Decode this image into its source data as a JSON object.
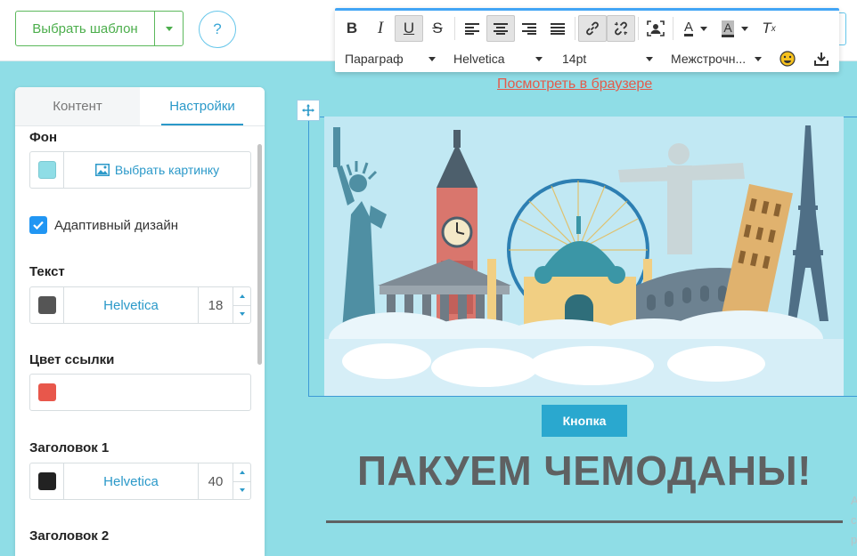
{
  "topbar": {
    "template_button": "Выбрать шаблон",
    "help_label": "?"
  },
  "editor_toolbar": {
    "paragraph_select": "Параграф",
    "font_select": "Helvetica",
    "size_select": "14pt",
    "line_height_select": "Межстрочн..."
  },
  "panel": {
    "tabs": [
      {
        "label": "Контент",
        "active": false
      },
      {
        "label": "Настройки",
        "active": true
      }
    ],
    "background": {
      "title": "Фон",
      "color": "#8fdde6",
      "pick_image_label": "Выбрать картинку"
    },
    "adaptive": {
      "label": "Адаптивный дизайн",
      "checked": true
    },
    "text": {
      "title": "Текст",
      "color": "#555555",
      "font": "Helvetica",
      "size": "18"
    },
    "link_color": {
      "title": "Цвет ссылки",
      "color": "#e8574b"
    },
    "heading1": {
      "title": "Заголовок 1",
      "color": "#222222",
      "font": "Helvetica",
      "size": "40"
    },
    "heading2": {
      "title": "Заголовок 2"
    }
  },
  "canvas": {
    "view_in_browser": "Посмотреть в браузере",
    "button_label": "Кнопка",
    "headline": "ПАКУЕМ ЧЕМОДАНЫ!",
    "edge_chars": [
      "А",
      "с",
      "р"
    ]
  }
}
